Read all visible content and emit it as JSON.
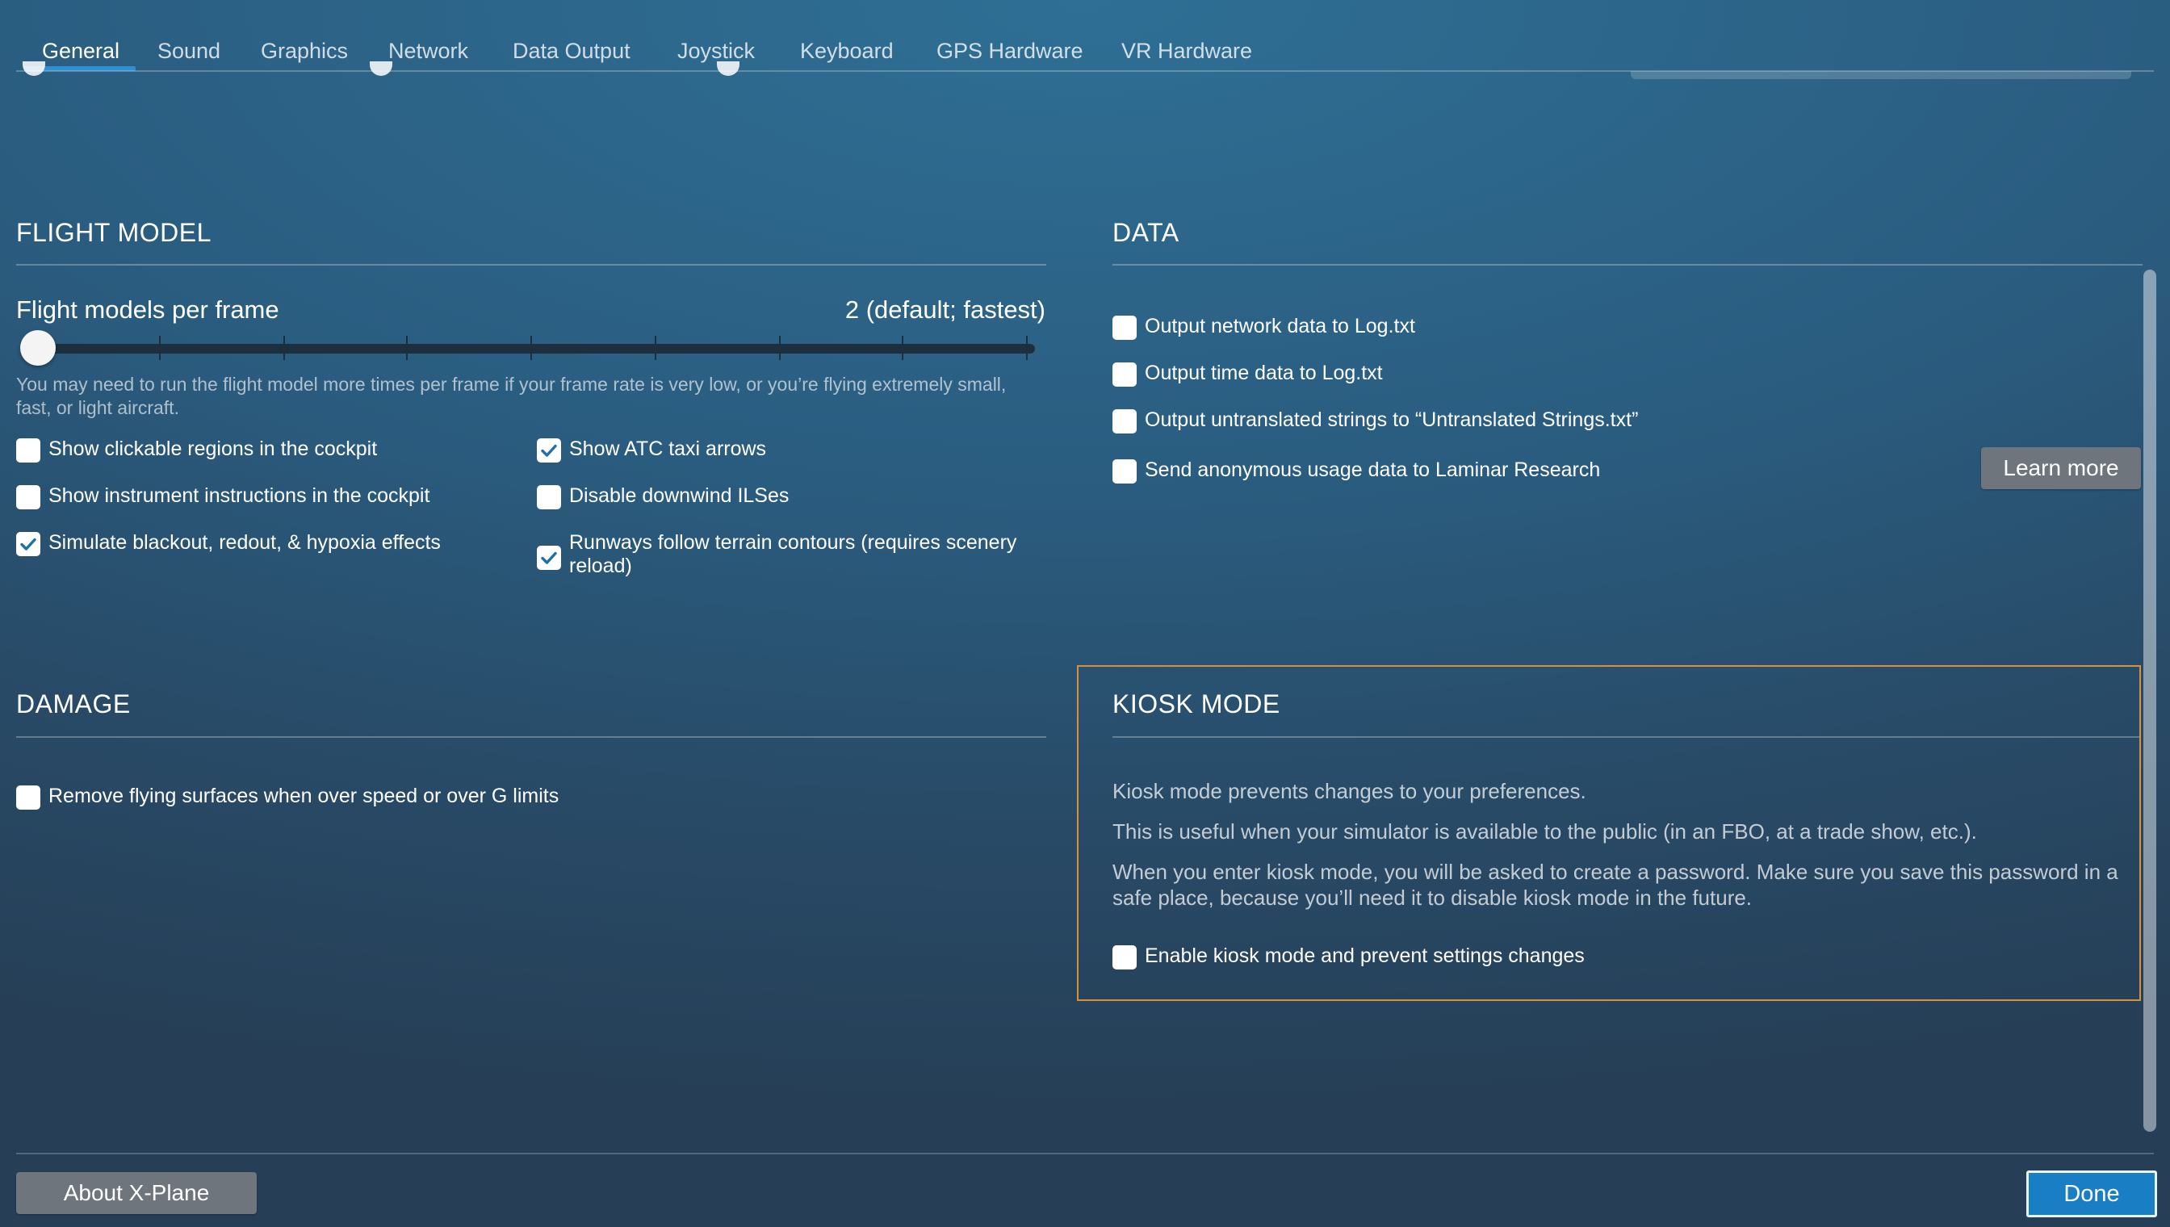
{
  "tabs": [
    {
      "label": "General",
      "active": true
    },
    {
      "label": "Sound"
    },
    {
      "label": "Graphics"
    },
    {
      "label": "Network"
    },
    {
      "label": "Data Output"
    },
    {
      "label": "Joystick"
    },
    {
      "label": "Keyboard"
    },
    {
      "label": "GPS Hardware"
    },
    {
      "label": "VR Hardware"
    }
  ],
  "flight_model": {
    "title": "FLIGHT MODEL",
    "slider_label": "Flight models per frame",
    "slider_value": "2 (default; fastest)",
    "slider_position": 0,
    "help_text": "You may need to run the flight model more times per frame if your frame rate is very low, or you’re flying extremely small, fast, or light aircraft.",
    "options": [
      {
        "label": "Show clickable regions in the cockpit",
        "checked": false
      },
      {
        "label": "Show ATC taxi arrows",
        "checked": true
      },
      {
        "label": "Show instrument instructions in the cockpit",
        "checked": false
      },
      {
        "label": "Disable downwind ILSes",
        "checked": false
      },
      {
        "label": "Simulate blackout, redout, & hypoxia effects",
        "checked": true
      },
      {
        "label": "Runways follow terrain contours (requires scenery reload)",
        "checked": true
      }
    ]
  },
  "data": {
    "title": "DATA",
    "options": [
      {
        "label": "Output network data to Log.txt",
        "checked": false
      },
      {
        "label": "Output time data to Log.txt",
        "checked": false
      },
      {
        "label": "Output untranslated strings to “Untranslated Strings.txt”",
        "checked": false
      },
      {
        "label": "Send anonymous usage data to Laminar Research",
        "checked": false
      }
    ],
    "learn_more_label": "Learn more"
  },
  "damage": {
    "title": "DAMAGE",
    "options": [
      {
        "label": "Remove flying surfaces when over speed or over G limits",
        "checked": false
      }
    ]
  },
  "kiosk": {
    "title": "KIOSK MODE",
    "p1": "Kiosk mode prevents changes to your preferences.",
    "p2": "This is useful when your simulator is available to the public (in an FBO, at a trade show, etc.).",
    "p3": "When you enter kiosk mode, you will be asked to create a password. Make sure you save this password in a safe place, because you’ll need it to disable kiosk mode in the future.",
    "option": {
      "label": "Enable kiosk mode and prevent settings changes",
      "checked": false
    }
  },
  "footer": {
    "about_label": "About X-Plane",
    "done_label": "Done"
  },
  "colors": {
    "accent": "#1a7ec4",
    "kiosk_border": "#d9903a",
    "checkmark": "#1f6fa8"
  }
}
